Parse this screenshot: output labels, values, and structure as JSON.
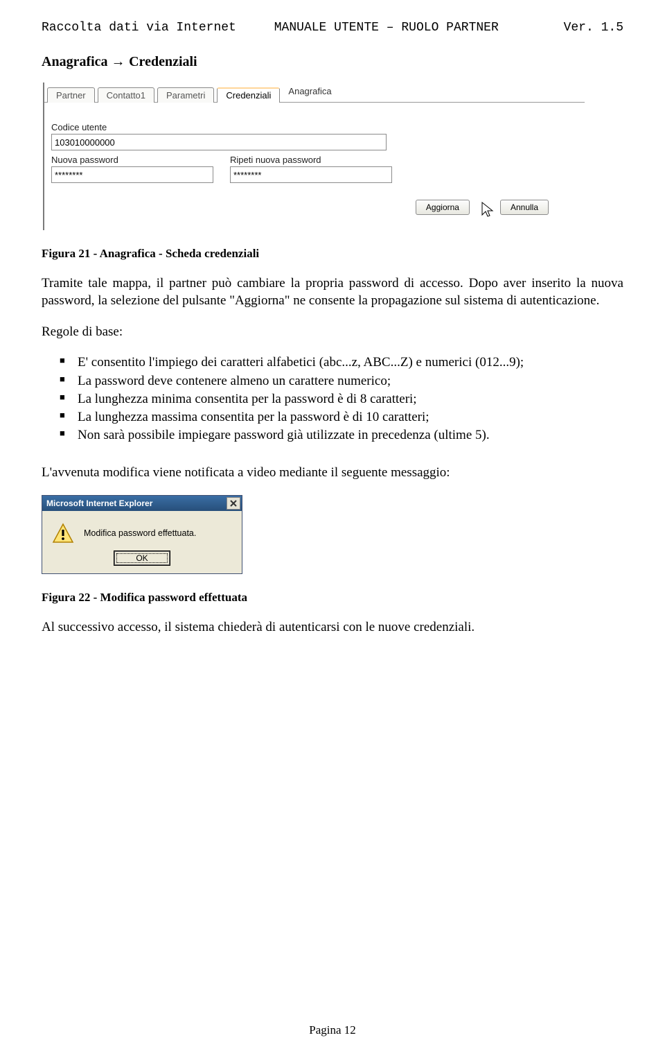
{
  "header": {
    "left": "Raccolta dati via Internet",
    "mid": "MANUALE UTENTE – RUOLO PARTNER",
    "right": "Ver. 1.5"
  },
  "section_title_pre": "Anagrafica",
  "section_title_post": "Credenziali",
  "tabs": {
    "t0": "Partner",
    "t1": "Contatto1",
    "t2": "Parametri",
    "t3": "Credenziali",
    "crumb": "Anagrafica"
  },
  "form": {
    "codice_label": "Codice utente",
    "codice_value": "103010000000",
    "nuova_label": "Nuova password",
    "nuova_value": "********",
    "ripeti_label": "Ripeti nuova password",
    "ripeti_value": "********",
    "aggiorna": "Aggiorna",
    "annulla": "Annulla"
  },
  "caption1": "Figura 21 - Anagrafica - Scheda credenziali",
  "para1": "Tramite tale mappa, il partner può cambiare la propria password di accesso. Dopo aver inserito la nuova password, la selezione del pulsante \"Aggiorna\" ne consente la propagazione sul sistema di autenticazione.",
  "para2": "Regole di base:",
  "rules": {
    "r0": "E' consentito l'impiego dei caratteri alfabetici (abc...z, ABC...Z) e numerici (012...9);",
    "r1": "La password deve contenere almeno un carattere numerico;",
    "r2": "La lunghezza minima consentita per la password è di 8 caratteri;",
    "r3": "La lunghezza massima consentita per la password è di 10 caratteri;",
    "r4": "Non sarà possibile impiegare password già utilizzate in precedenza (ultime 5)."
  },
  "para3": "L'avvenuta modifica viene notificata a video mediante il seguente messaggio:",
  "dialog": {
    "title": "Microsoft Internet Explorer",
    "message": "Modifica password effettuata.",
    "ok": "OK"
  },
  "caption2": "Figura 22 - Modifica password effettuata",
  "para4": "Al successivo accesso, il sistema chiederà di autenticarsi con le nuove credenziali.",
  "footer": "Pagina 12"
}
